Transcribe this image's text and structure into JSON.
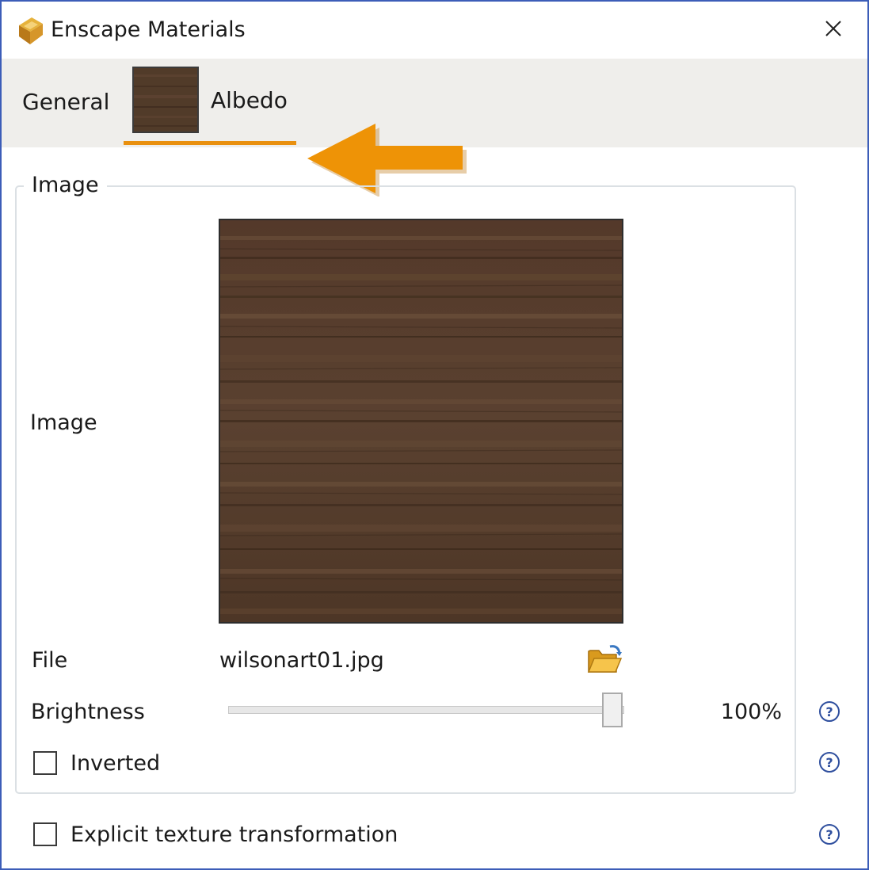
{
  "window": {
    "title": "Enscape Materials",
    "app_icon": "enscape-logo-icon",
    "close_icon": "close-icon"
  },
  "tabs": [
    {
      "label": "General",
      "active": false
    },
    {
      "label": "Albedo",
      "active": true,
      "thumbnail": "wood-texture-thumbnail"
    }
  ],
  "annotation": {
    "icon": "left-arrow-annotation-icon",
    "color": "#ee9306"
  },
  "image_group": {
    "legend": "Image",
    "image_label": "Image",
    "file_label": "File",
    "file_value": "wilsonart01.jpg",
    "folder_icon": "open-folder-icon",
    "brightness_label": "Brightness",
    "brightness_value": "100%",
    "brightness_level": 1.0,
    "inverted_label": "Inverted",
    "inverted_checked": false
  },
  "explicit_texture": {
    "label": "Explicit texture transformation",
    "checked": false
  },
  "help_icon": "help-icon",
  "colors": {
    "accent": "#e9900f",
    "window_border": "#3c5db8",
    "tabbar_bg": "#efeeeb",
    "wood": "#513b29"
  }
}
